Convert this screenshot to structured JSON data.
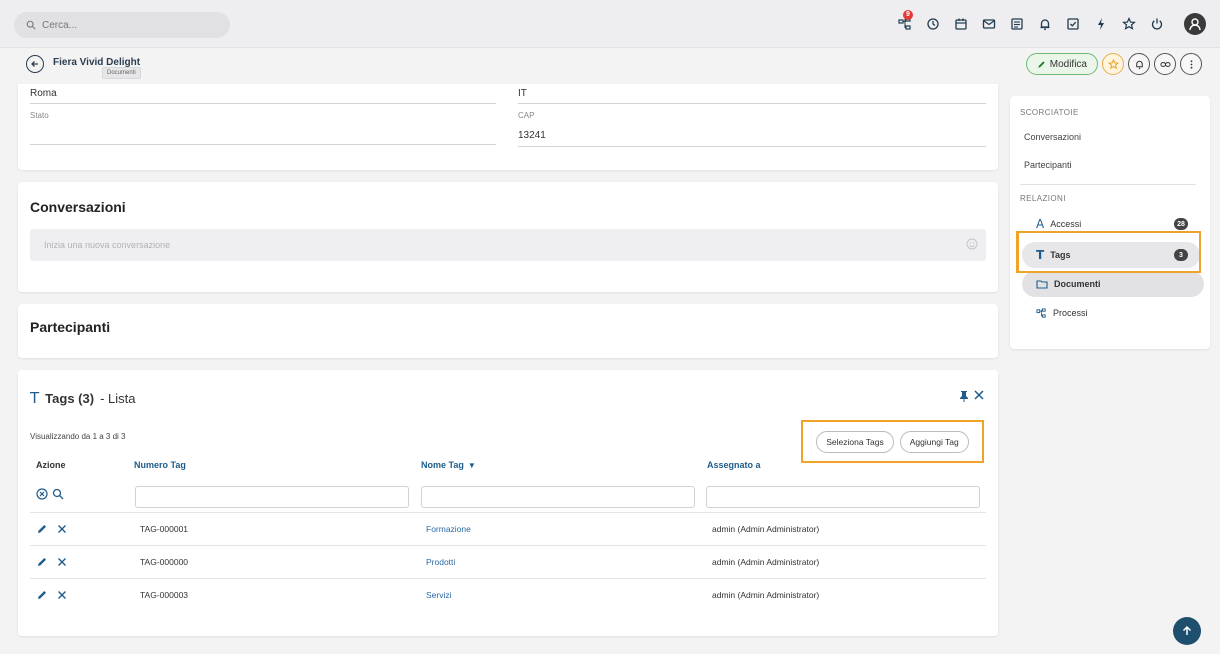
{
  "topbar": {
    "search_placeholder": "Cerca...",
    "icons": [
      "processes-icon",
      "history-icon",
      "calendar-icon",
      "mail-icon",
      "notes-icon",
      "bell-icon",
      "checklist-icon",
      "bolt-icon",
      "star-icon",
      "power-icon"
    ],
    "notification_count": "9"
  },
  "header": {
    "record_title": "Fiera Vivid Delight",
    "tooltip": "Documenti",
    "edit_label": "Modifica"
  },
  "address": {
    "city_value": "Roma",
    "province_value": "IT",
    "state_label": "Stato",
    "state_value": "",
    "cap_label": "CAP",
    "cap_value": "13241"
  },
  "conversations": {
    "title": "Conversazioni",
    "input_placeholder": "Inizia una nuova conversazione"
  },
  "participants": {
    "title": "Partecipanti"
  },
  "tags_panel": {
    "title_bold": "Tags (3)",
    "title_suffix": " - Lista",
    "showing": "Visualizzando da 1 a 3 di 3",
    "select_button": "Seleziona Tags",
    "add_button": "Aggiungi Tag",
    "columns": [
      "Azione",
      "Numero Tag",
      "Nome Tag",
      "Assegnato a"
    ],
    "rows": [
      {
        "number": "TAG-000001",
        "name": "Formazione",
        "assigned": "admin (Admin Administrator)"
      },
      {
        "number": "TAG-000000",
        "name": "Prodotti",
        "assigned": "admin (Admin Administrator)"
      },
      {
        "number": "TAG-000003",
        "name": "Servizi",
        "assigned": "admin (Admin Administrator)"
      }
    ]
  },
  "sidebar": {
    "shortcuts_heading": "SCORCIATOIE",
    "shortcuts": [
      "Conversazioni",
      "Partecipanti"
    ],
    "relations_heading": "RELAZIONI",
    "relations": [
      {
        "label": "Accessi",
        "badge": "28"
      },
      {
        "label": "Tags",
        "badge": "3"
      },
      {
        "label": "Documenti",
        "badge": ""
      },
      {
        "label": "Processi",
        "badge": ""
      }
    ]
  },
  "colors": {
    "accent": "#1f5c8b",
    "highlight": "#f0a329",
    "edit_green": "#6fba74"
  }
}
